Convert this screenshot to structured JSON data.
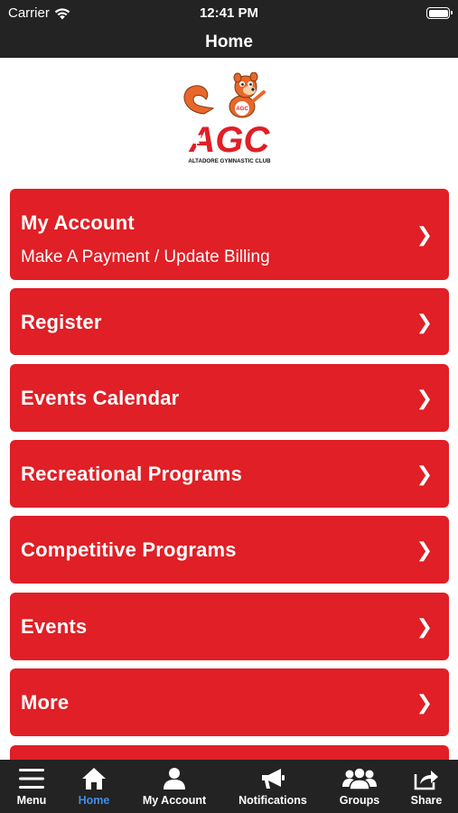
{
  "status_bar": {
    "carrier": "Carrier",
    "time": "12:41 PM"
  },
  "nav": {
    "title": "Home"
  },
  "logo": {
    "brand": "AGC",
    "club_name": "ALTADORE GYMNASTIC CLUB",
    "mascot_shirt": "AGC"
  },
  "menu": {
    "items": [
      {
        "label": "My Account",
        "subtitle": "Make A Payment / Update Billing",
        "chevron": "❯"
      },
      {
        "label": "Register",
        "chevron": "❯"
      },
      {
        "label": "Events Calendar",
        "chevron": "❯"
      },
      {
        "label": "Recreational Programs",
        "chevron": "❯"
      },
      {
        "label": "Competitive Programs",
        "chevron": "❯"
      },
      {
        "label": "Events",
        "chevron": "❯"
      },
      {
        "label": "More",
        "chevron": "❯"
      }
    ]
  },
  "tab_bar": {
    "tabs": [
      {
        "label": "Menu",
        "icon": "hamburger-icon"
      },
      {
        "label": "Home",
        "icon": "home-icon",
        "active": true
      },
      {
        "label": "My Account",
        "icon": "person-icon"
      },
      {
        "label": "Notifications",
        "icon": "megaphone-icon"
      },
      {
        "label": "Groups",
        "icon": "group-icon"
      },
      {
        "label": "Share",
        "icon": "share-icon"
      }
    ]
  },
  "colors": {
    "accent_red": "#e01f26",
    "bar_dark": "#232323",
    "active_tab": "#3e8ee6"
  }
}
